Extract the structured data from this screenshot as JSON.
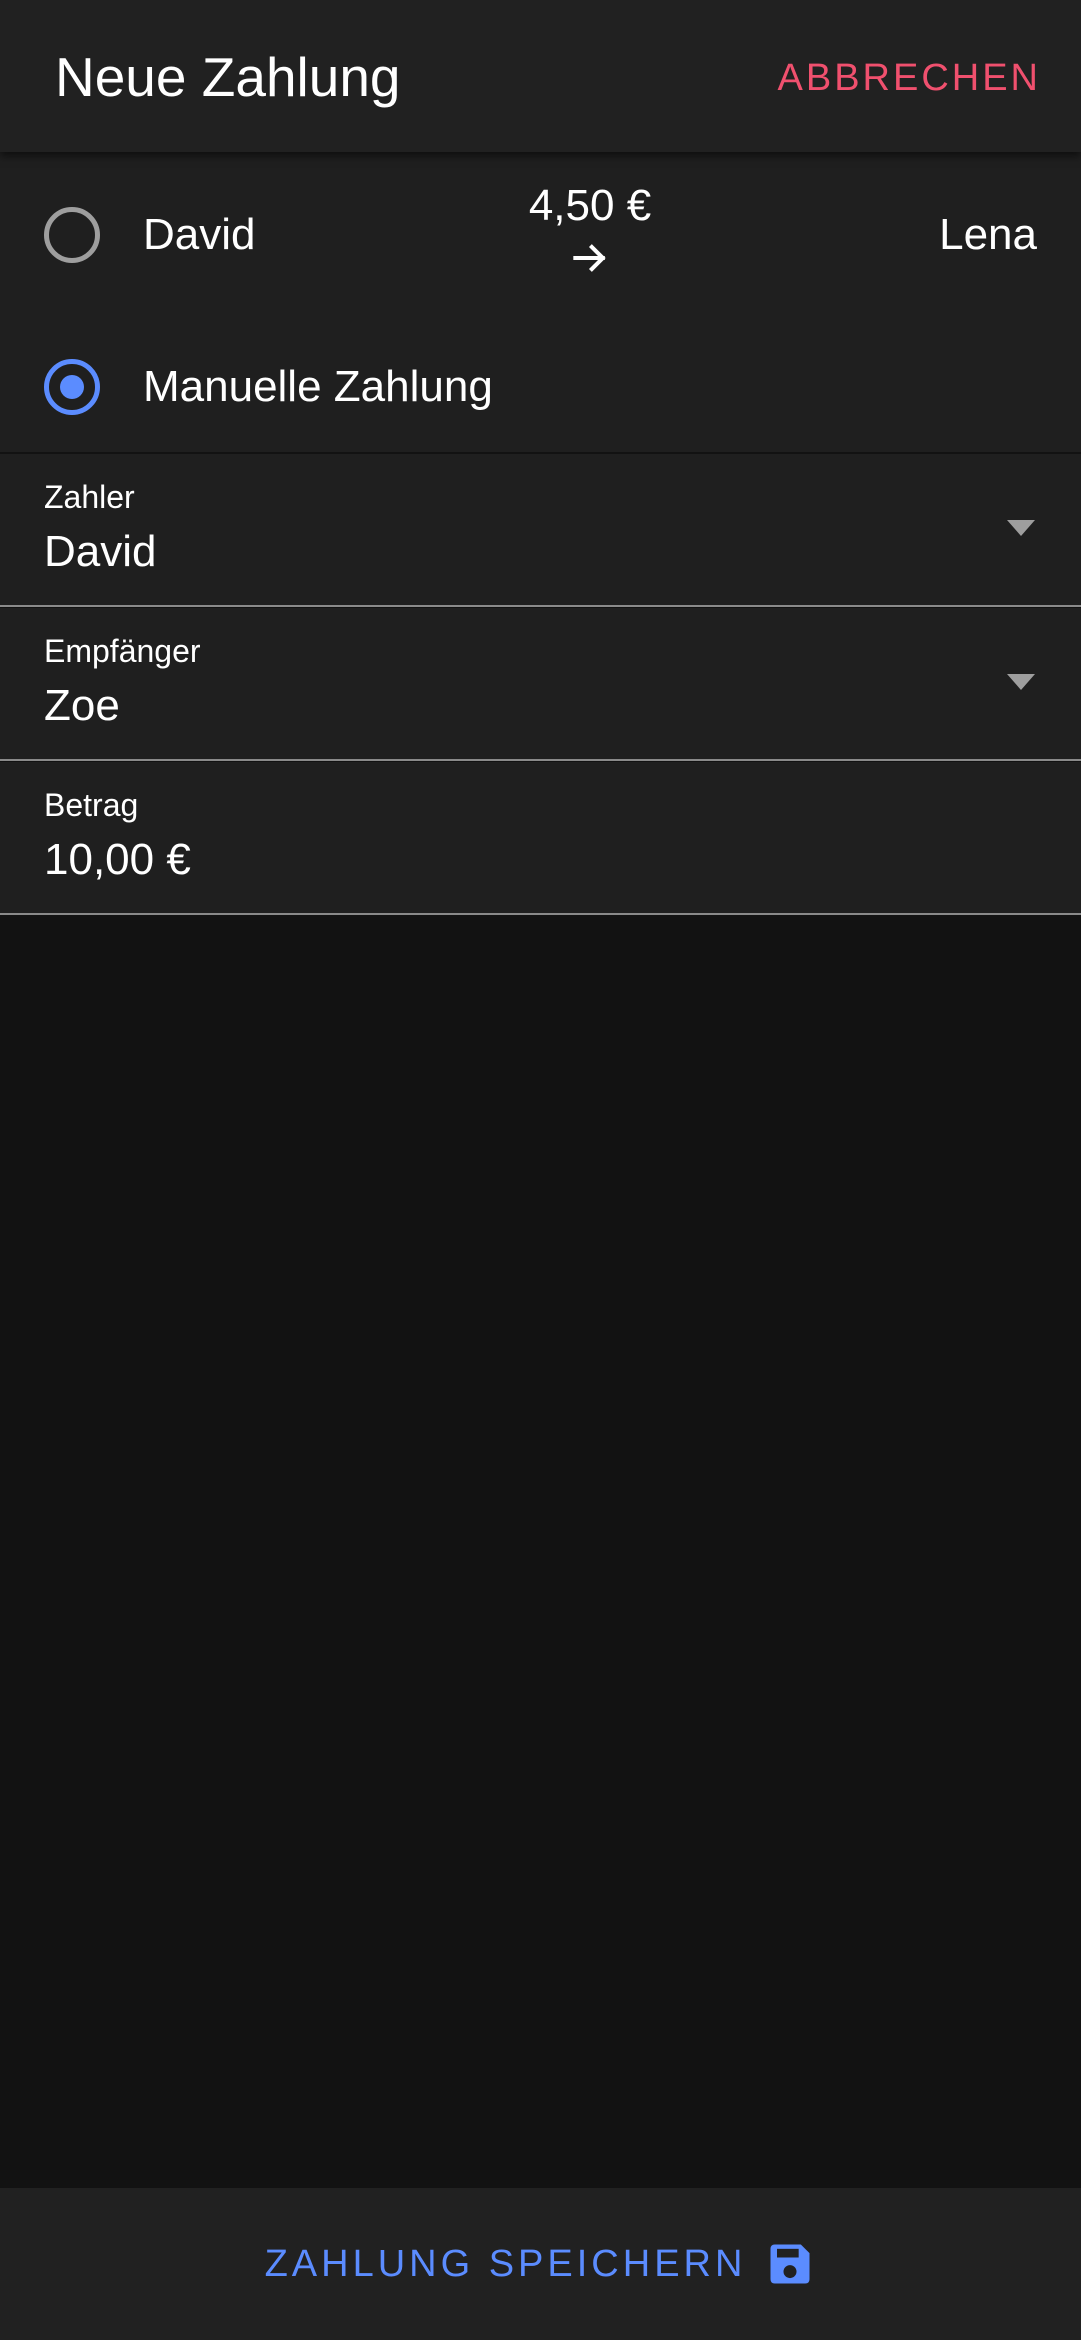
{
  "app_bar": {
    "title": "Neue Zahlung",
    "cancel_label": "ABBRECHEN"
  },
  "payment_options": {
    "suggested": {
      "selected": false,
      "from": "David",
      "amount": "4,50 €",
      "to": "Lena"
    },
    "manual": {
      "selected": true,
      "label": "Manuelle Zahlung"
    }
  },
  "form": {
    "payer": {
      "label": "Zahler",
      "value": "David"
    },
    "recipient": {
      "label": "Empfänger",
      "value": "Zoe"
    },
    "amount": {
      "label": "Betrag",
      "value": "10,00 €"
    }
  },
  "footer": {
    "save_label": "ZAHLUNG SPEICHERN"
  },
  "icons": {
    "arrow": "arrow-right-icon",
    "dropdown": "chevron-down-icon",
    "save": "floppy-disk-icon"
  },
  "colors": {
    "accent": "#5b8cff",
    "danger": "#f0506e",
    "surface": "#1f1f1f",
    "app_bar": "#212121",
    "background": "#121212"
  }
}
